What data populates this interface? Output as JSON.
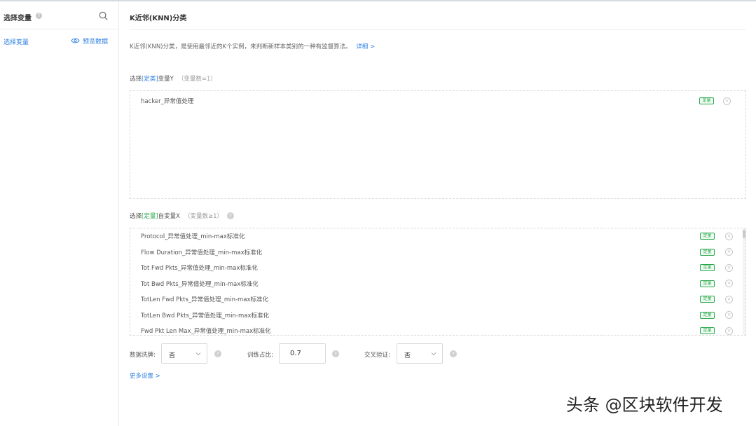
{
  "sidebar": {
    "title": "选择变量",
    "help": "?",
    "tab_label": "选择变量",
    "preview_label": "预览数据"
  },
  "main": {
    "title": "K近邻(KNN)分类",
    "description": "K近邻(KNN)分类，是使用最邻近的K个实例，来判断新样本类别的一种有监督算法。",
    "detail_link": "详细 >",
    "y_section": {
      "prefix": "选择",
      "tag": "[定类]",
      "label": "变量Y",
      "count": "（变量数=1）",
      "items": [
        {
          "name": "hacker_异常值处理",
          "badge": "定量"
        }
      ]
    },
    "x_section": {
      "prefix": "选择",
      "tag": "[定量]",
      "label": "自变量X",
      "count": "（变量数≥1）",
      "help": "?",
      "items": [
        {
          "name": "Protocol_异常值处理_min-max标准化",
          "badge": "定量"
        },
        {
          "name": "Flow Duration_异常值处理_min-max标准化",
          "badge": "定量"
        },
        {
          "name": "Tot Fwd Pkts_异常值处理_min-max标准化",
          "badge": "定量"
        },
        {
          "name": "Tot Bwd Pkts_异常值处理_min-max标准化",
          "badge": "定量"
        },
        {
          "name": "TotLen Fwd Pkts_异常值处理_min-max标准化",
          "badge": "定量"
        },
        {
          "name": "TotLen Bwd Pkts_异常值处理_min-max标准化",
          "badge": "定量"
        },
        {
          "name": "Fwd Pkt Len Max_异常值处理_min-max标准化",
          "badge": "定量"
        }
      ]
    },
    "settings": {
      "shuffle_label": "数据洗牌:",
      "shuffle_value": "否",
      "train_ratio_label": "训练占比:",
      "train_ratio_value": "0.7",
      "cross_val_label": "交叉验证:",
      "cross_val_value": "否",
      "help": "?"
    },
    "more_settings": "更多设置 >"
  },
  "remove_glyph": "×",
  "watermark": "头条 @区块软件开发",
  "colors": {
    "link": "#2d7fe0",
    "badge": "#2aa84a",
    "border": "#d9d9d9"
  }
}
